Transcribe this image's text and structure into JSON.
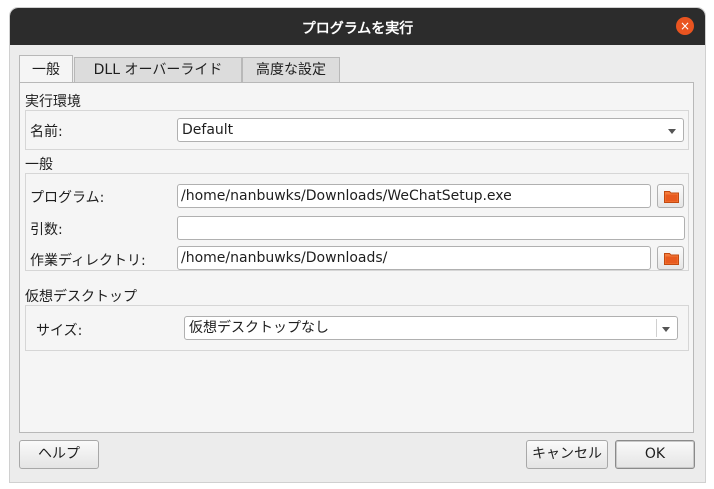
{
  "window": {
    "title": "プログラムを実行",
    "close_glyph": "×"
  },
  "tabs": [
    {
      "label": "一般",
      "active": true
    },
    {
      "label": "DLL オーバーライド",
      "active": false
    },
    {
      "label": "高度な設定",
      "active": false
    }
  ],
  "environment": {
    "group_label": "実行環境",
    "name_label": "名前:",
    "name_value": "Default"
  },
  "general": {
    "group_label": "一般",
    "program_label": "プログラム:",
    "program_value": "/home/nanbuwks/Downloads/WeChatSetup.exe",
    "args_label": "引数:",
    "args_value": "",
    "workdir_label": "作業ディレクトリ:",
    "workdir_value": "/home/nanbuwks/Downloads/"
  },
  "virtual_desktop": {
    "group_label": "仮想デスクトップ",
    "size_label": "サイズ:",
    "size_value": "仮想デスクトップなし"
  },
  "footer": {
    "help_label": "ヘルプ",
    "cancel_label": "キャンセル",
    "ok_label": "OK"
  },
  "colors": {
    "titlebar": "#2c2c2c",
    "close": "#e95420",
    "folder": "#e85a1e"
  },
  "icons": [
    "close-icon",
    "folder-icon",
    "chevron-down-icon"
  ]
}
